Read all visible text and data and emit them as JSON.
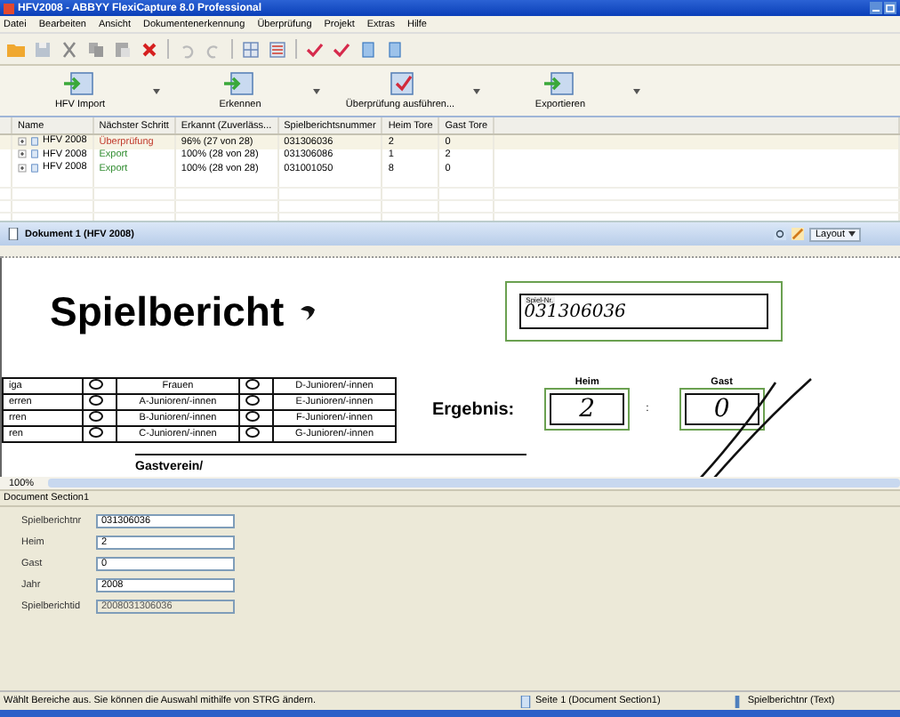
{
  "window": {
    "title": "HFV2008 - ABBYY FlexiCapture 8.0 Professional"
  },
  "menu": [
    "Datei",
    "Bearbeiten",
    "Ansicht",
    "Dokumentenerkennung",
    "Überprüfung",
    "Projekt",
    "Extras",
    "Hilfe"
  ],
  "big_toolbar": [
    "HFV Import",
    "Erkennen",
    "Überprüfung ausführen...",
    "Exportieren"
  ],
  "table": {
    "columns": [
      "Name",
      "Nächster Schritt",
      "Erkannt (Zuverläss...",
      "Spielberichtsnummer",
      "Heim Tore",
      "Gast Tore"
    ],
    "rows": [
      {
        "name": "HFV 2008",
        "step": "Überprüfung",
        "kind": "review",
        "recognized": "96% (27 von 28)",
        "number": "031306036",
        "home": "2",
        "away": "0",
        "selected": true
      },
      {
        "name": "HFV 2008",
        "step": "Export",
        "kind": "export",
        "recognized": "100% (28 von 28)",
        "number": "031306086",
        "home": "1",
        "away": "2",
        "selected": false
      },
      {
        "name": "HFV 2008",
        "step": "Export",
        "kind": "export",
        "recognized": "100% (28 von 28)",
        "number": "031001050",
        "home": "8",
        "away": "0",
        "selected": false
      }
    ]
  },
  "document_panel": {
    "title": "Dokument 1 (HFV 2008)",
    "layout_button": "Layout"
  },
  "form": {
    "title": "Spielbericht",
    "game_no_label": "Spiel-Nr.",
    "game_no": "031306036",
    "league_rows": [
      {
        "left": "iga",
        "middle": "Frauen",
        "right": "D-Junioren/-innen"
      },
      {
        "left": "erren",
        "middle": "A-Junioren/-innen",
        "right": "E-Junioren/-innen"
      },
      {
        "left": "rren",
        "middle": "B-Junioren/-innen",
        "right": "F-Junioren/-innen"
      },
      {
        "left": "ren",
        "middle": "C-Junioren/-innen",
        "right": "G-Junioren/-innen"
      }
    ],
    "result_label": "Ergebnis:",
    "home_label": "Heim",
    "away_label": "Gast",
    "home_score": "2",
    "separator": ":",
    "away_score": "0",
    "guest_label": "Gastverein/"
  },
  "zoom": "100%",
  "section": {
    "title": "Document Section1",
    "fields": [
      {
        "label": "Spielberichtnr",
        "value": "031306036",
        "disabled": false
      },
      {
        "label": "Heim",
        "value": "2",
        "disabled": false
      },
      {
        "label": "Gast",
        "value": "0",
        "disabled": false
      },
      {
        "label": "Jahr",
        "value": "2008",
        "disabled": false
      },
      {
        "label": "Spielberichtid",
        "value": "2008031306036",
        "disabled": true
      }
    ]
  },
  "status_bar": {
    "hint": "Wählt Bereiche aus. Sie können die Auswahl mithilfe von STRG ändern.",
    "page": "Seite 1 (Document Section1)",
    "field": "Spielberichtnr (Text)"
  }
}
